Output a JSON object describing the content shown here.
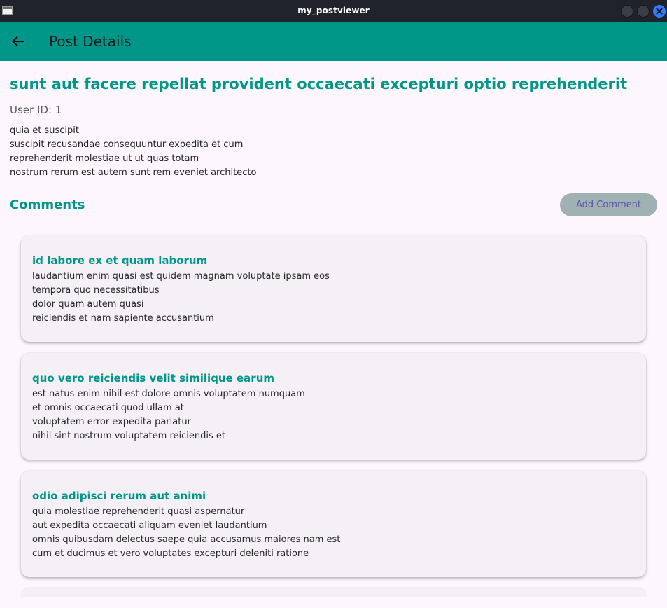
{
  "window": {
    "title": "my_postviewer"
  },
  "appbar": {
    "title": "Post Details"
  },
  "post": {
    "title": "sunt aut facere repellat provident occaecati excepturi optio reprehenderit",
    "user_id": "User ID: 1",
    "body_lines": [
      "quia et suscipit",
      "suscipit recusandae consequuntur expedita et cum",
      "reprehenderit molestiae ut ut quas totam",
      "nostrum rerum est autem sunt rem eveniet architecto"
    ]
  },
  "comments_section": {
    "heading": "Comments",
    "add_button_label": "Add Comment",
    "items": [
      {
        "name": "id labore ex et quam laborum",
        "body_lines": [
          "laudantium enim quasi est quidem magnam voluptate ipsam eos",
          "tempora quo necessitatibus",
          "dolor quam autem quasi",
          "reiciendis et nam sapiente accusantium"
        ]
      },
      {
        "name": "quo vero reiciendis velit similique earum",
        "body_lines": [
          "est natus enim nihil est dolore omnis voluptatem numquam",
          "et omnis occaecati quod ullam at",
          "voluptatem error expedita pariatur",
          "nihil sint nostrum voluptatem reiciendis et"
        ]
      },
      {
        "name": "odio adipisci rerum aut animi",
        "body_lines": [
          "quia molestiae reprehenderit quasi aspernatur",
          "aut expedita occaecati aliquam eveniet laudantium",
          "omnis quibusdam delectus saepe quia accusamus maiores nam est",
          "cum et ducimus et vero voluptates excepturi deleniti ratione"
        ]
      }
    ]
  },
  "colors": {
    "primary": "#009788",
    "background": "#fdf7fd",
    "card": "#f4f0f6",
    "button_bg": "#9fb1b2",
    "button_text": "#5a56a8",
    "titlebar": "#20232b"
  },
  "icons": {
    "app": "app-window-icon",
    "back": "arrow-back-icon",
    "minimize": "minimize-icon",
    "maximize": "maximize-icon",
    "close": "close-icon"
  }
}
